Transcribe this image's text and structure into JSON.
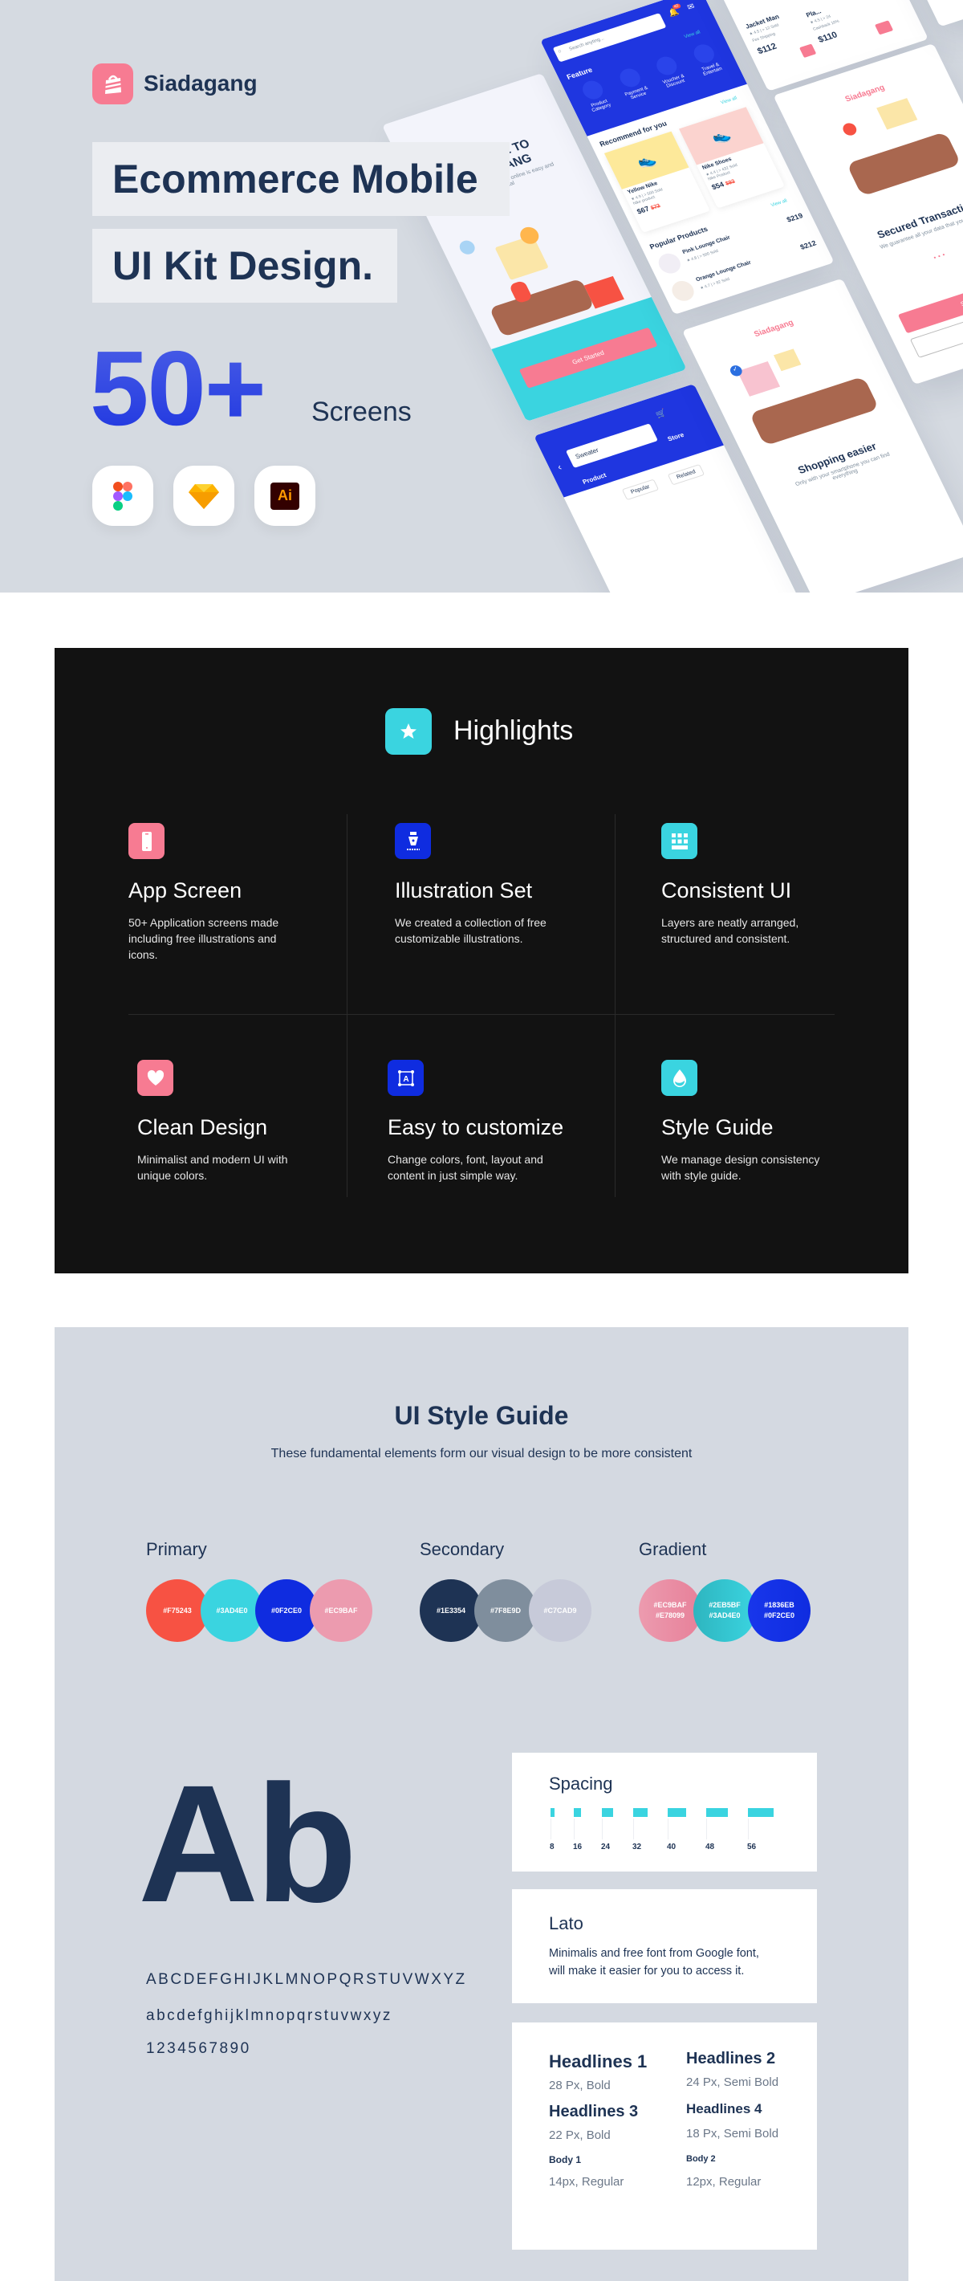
{
  "hero": {
    "brand": "Siadagang",
    "title_line1": "Ecommerce Mobile",
    "title_line2": "UI Kit Design.",
    "count": "50+",
    "count_label": "Screens",
    "tools": [
      {
        "icon": "figma-icon"
      },
      {
        "icon": "sketch-icon"
      },
      {
        "icon": "illustrator-icon",
        "label": "Ai"
      }
    ],
    "mockups": {
      "welcome": {
        "title1": "WELCOME TO",
        "title2": "SIADAGANG",
        "subtitle": "The place to buy and sell online is easy and practical",
        "button": "Get Started"
      },
      "home": {
        "search_placeholder": "Search anyting...",
        "badge": "40",
        "feature_label": "Feature",
        "view_all": "View all",
        "features": [
          "Product Category",
          "Payment & Service",
          "Voucher & Discount",
          "Travel & Entertain"
        ],
        "recommend_title": "Recommend for you",
        "products": [
          {
            "name": "Yellow Nike",
            "rating": "4.9",
            "sold": "> 500 Sold",
            "brand": "Nike product",
            "price": "$67",
            "old_price": "$72"
          },
          {
            "name": "Nike Shoes",
            "rating": "4.4",
            "sold": "> 432 Sold",
            "brand": "Nike Product",
            "price": "$54",
            "old_price": "$92"
          }
        ],
        "popular_title": "Popular Products",
        "popular": [
          {
            "name": "Pink Lounge Chair",
            "rating": "4.8",
            "sold": "> 500 Sold",
            "price": "$219"
          },
          {
            "name": "Orange Lounge Chair",
            "rating": "4.7",
            "sold": "> 82 Sold",
            "price": "$212"
          }
        ]
      },
      "top_products": [
        {
          "name": "Jacket Man",
          "rating": "4.5",
          "sold": "> 12 Sold",
          "note": "Fee Shipping",
          "price": "$112"
        },
        {
          "name": "Pla...",
          "rating": "4.5",
          "sold": "> 24",
          "note": "Cashback 10%",
          "price": "$110"
        }
      ],
      "secured": {
        "brand": "Siadagang",
        "title": "Secured Transaction",
        "subtitle": "We guarantee all your data that you provide",
        "button": "Sign"
      },
      "shopping": {
        "brand": "Siadagang",
        "title": "Shopping easier",
        "subtitle": "Only with your smartphone you can find everything"
      },
      "search": {
        "query": "Sweater",
        "tab_store": "Store",
        "tab_product": "Product",
        "chips": [
          "Popular",
          "Related"
        ]
      }
    }
  },
  "highlights": {
    "title": "Highlights",
    "items": [
      {
        "title": "App Screen",
        "desc": "50+ Application screens made including free illustrations and icons.",
        "icon": "smartphone-icon",
        "color": "#F77B92"
      },
      {
        "title": "Illustration Set",
        "desc": "We created a collection of free customizable illustrations.",
        "icon": "pen-nib-icon",
        "color": "#0F2CE0"
      },
      {
        "title": "Consistent UI",
        "desc": "Layers are neatly arranged, structured and consistent.",
        "icon": "grid-icon",
        "color": "#3AD4E0"
      },
      {
        "title": "Clean Design",
        "desc": "Minimalist and modern UI with unique colors.",
        "icon": "heart-icon",
        "color": "#F77B92"
      },
      {
        "title": "Easy to customize",
        "desc": "Change colors, font, layout and content in just simple way.",
        "icon": "text-frame-icon",
        "color": "#0F2CE0"
      },
      {
        "title": "Style Guide",
        "desc": "We manage design consistency with style guide.",
        "icon": "drop-icon",
        "color": "#3AD4E0"
      }
    ]
  },
  "style_guide": {
    "title": "UI Style Guide",
    "subtitle": "These fundamental elements form our visual design to be more consistent",
    "primary": {
      "label": "Primary",
      "colors": [
        "#F75243",
        "#3AD4E0",
        "#0F2CE0",
        "#EC9BAF"
      ]
    },
    "secondary": {
      "label": "Secondary",
      "colors": [
        "#1E3354",
        "#7F8E9D",
        "#C7CAD9"
      ]
    },
    "gradient": {
      "label": "Gradient",
      "colors": [
        [
          "#EC9BAF",
          "#E78099"
        ],
        [
          "#2EB5BF",
          "#3AD4E0"
        ],
        [
          "#1836EB",
          "#0F2CE0"
        ]
      ]
    },
    "type_sample": "Ab",
    "uppercase": "ABCDEFGHIJKLMNOPQRSTUVWXYZ",
    "lowercase": "abcdefghijklmnopqrstuvwxyz",
    "digits": "1234567890",
    "spacing": {
      "title": "Spacing",
      "values": [
        "8",
        "16",
        "24",
        "32",
        "40",
        "48",
        "56"
      ]
    },
    "font": {
      "name": "Lato",
      "desc_line1": "Minimalis and free font from Google font,",
      "desc_line2": "will make it easier for you to access it."
    },
    "type_scale": [
      {
        "name": "Headlines 1",
        "spec": "28 Px, Bold"
      },
      {
        "name": "Headlines 2",
        "spec": "24 Px, Semi Bold"
      },
      {
        "name": "Headlines 3",
        "spec": "22 Px, Bold"
      },
      {
        "name": "Headlines 4",
        "spec": "18 Px, Semi Bold"
      },
      {
        "name": "Body 1",
        "spec": "14px, Regular"
      },
      {
        "name": "Body 2",
        "spec": "12px, Regular"
      }
    ]
  }
}
